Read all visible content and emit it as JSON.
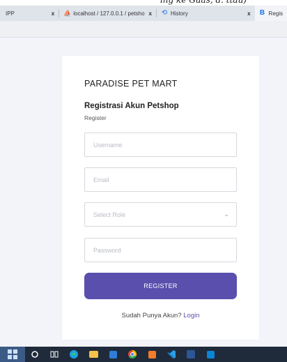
{
  "browser": {
    "tabs": [
      {
        "label": "IPP",
        "favicon": "xampp-icon",
        "closable": true
      },
      {
        "label": "localhost / 127.0.0.1 / petsho",
        "favicon": "phpmyadmin-icon",
        "closable": true
      },
      {
        "label": "History",
        "favicon": "history-icon",
        "closable": true
      },
      {
        "label": "Regis",
        "favicon": "bootstrap-icon",
        "active": true
      }
    ],
    "close_glyph": "x"
  },
  "form": {
    "brand": "PARADISE PET MART",
    "title": "Registrasi Akun Petshop",
    "subtitle": "Register",
    "username_placeholder": "Username",
    "email_placeholder": "Email",
    "role_placeholder": "Select Role",
    "password_placeholder": "Password",
    "submit_label": "REGISTER",
    "login_prompt": "Sudah Punya Akun?",
    "login_link": "Login"
  },
  "taskbar": {
    "icons": [
      "start-icon",
      "search-icon",
      "task-view-icon",
      "edge-icon",
      "file-explorer-icon",
      "store-icon",
      "chrome-icon",
      "xampp-icon",
      "vscode-icon",
      "word-icon",
      "photos-icon"
    ]
  },
  "colors": {
    "accent": "#5a4fad",
    "page_bg": "#f2f4fa",
    "taskbar": "#1f2a3a"
  }
}
